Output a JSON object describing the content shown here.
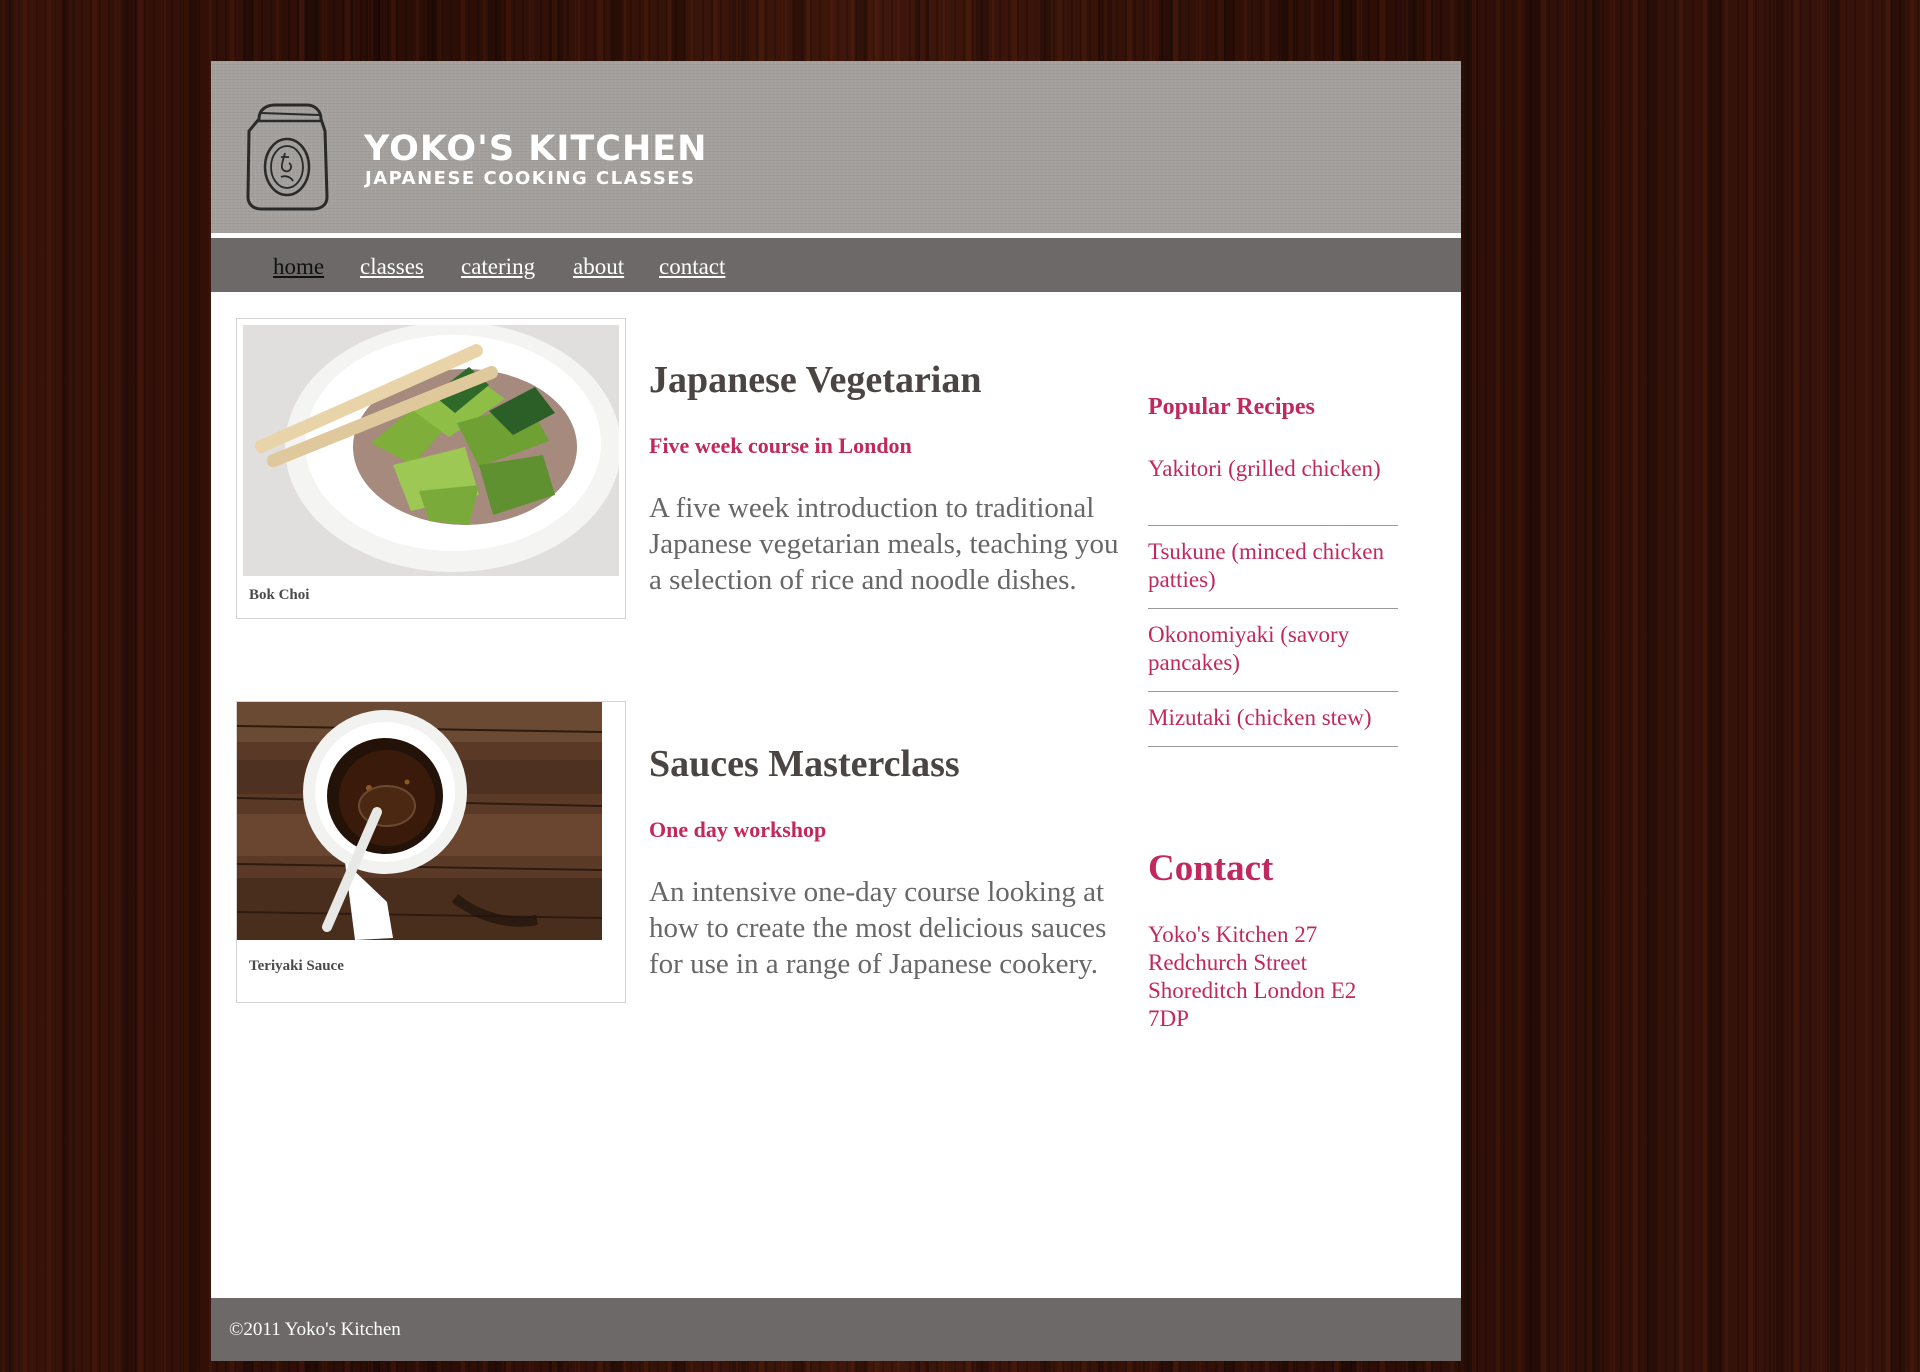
{
  "header": {
    "title": "YOKO'S KITCHEN",
    "subtitle": "JAPANESE COOKING CLASSES",
    "logo_icon": "jar-icon"
  },
  "nav": {
    "items": [
      {
        "label": "home",
        "active": true
      },
      {
        "label": "classes",
        "active": false
      },
      {
        "label": "catering",
        "active": false
      },
      {
        "label": "about",
        "active": false
      },
      {
        "label": "contact",
        "active": false
      }
    ]
  },
  "courses": [
    {
      "title": "Japanese Vegetarian",
      "subtitle": "Five week course in London",
      "description": "A five week introduction to traditional Japanese vegetarian meals, teaching you a selection of rice and noodle dishes.",
      "image_caption": "Bok Choi"
    },
    {
      "title": "Sauces Masterclass",
      "subtitle": "One day workshop",
      "description": "An intensive one-day course looking at how to create the most delicious sauces for use in a range of Japanese cookery.",
      "image_caption": "Teriyaki Sauce"
    }
  ],
  "sidebar": {
    "popular_heading": "Popular Recipes",
    "recipes": [
      "Yakitori (grilled chicken)",
      "Tsukune (minced chicken patties)",
      "Okonomiyaki (savory pancakes)",
      "Mizutaki (chicken stew)"
    ],
    "contact_heading": "Contact",
    "contact_address": "Yoko's Kitchen 27 Redchurch Street Shoreditch London E2 7DP"
  },
  "footer": {
    "copyright": "©2011 Yoko's Kitchen"
  },
  "colors": {
    "accent": "#c0285e",
    "nav_bg": "#6c6968",
    "header_bg": "#a3a09d",
    "heading_text": "#4a4543",
    "body_text": "#676767"
  }
}
